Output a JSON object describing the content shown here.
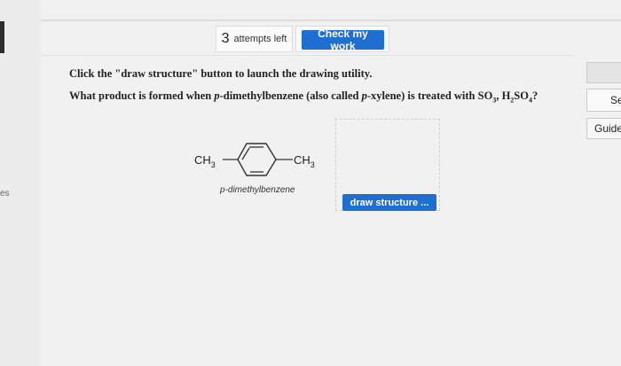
{
  "left": {
    "text": "es"
  },
  "toolbar": {
    "attempts_count": "3",
    "attempts_label": "attempts left",
    "check_label": "Check my work"
  },
  "question": {
    "instruction": "Click the \"draw structure\" button to launch the drawing utility.",
    "prompt_a": "What product is formed when ",
    "p1": "p",
    "prompt_b": "-dimethylbenzene (also called ",
    "p2": "p",
    "prompt_c": "-xylene) is treated with SO",
    "sub3": "3",
    "prompt_d": ", H",
    "sub2": "2",
    "prompt_e": "SO",
    "sub4": "4",
    "prompt_f": "?"
  },
  "molecule": {
    "left_group": "CH",
    "left_sub": "3",
    "right_group": "CH",
    "right_sub": "3",
    "name": "p-dimethylbenzene"
  },
  "draw": {
    "button_label": "draw structure ..."
  },
  "right_panel": {
    "btn2_label": "Se",
    "btn3_label": "Guide"
  }
}
